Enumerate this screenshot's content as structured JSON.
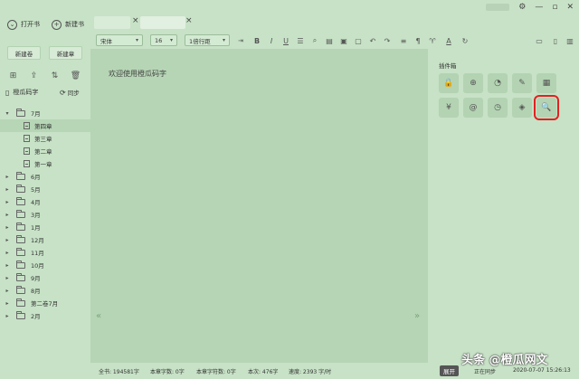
{
  "topbar": {
    "open_book": "打开书",
    "new_book": "新建书",
    "tab_close": "×"
  },
  "toolbar": {
    "font": "宋体",
    "size": "16",
    "line_spacing": "1倍行距"
  },
  "left": {
    "new_volume": "新建卷",
    "new_chapter": "新建章",
    "book_name": "橙瓜码字",
    "sync": "同步"
  },
  "tree": [
    {
      "label": "7月",
      "type": "folder",
      "expanded": true
    },
    {
      "label": "第四章",
      "type": "doc",
      "active": true
    },
    {
      "label": "第三章",
      "type": "doc"
    },
    {
      "label": "第二章",
      "type": "doc"
    },
    {
      "label": "第一章",
      "type": "doc"
    },
    {
      "label": "6月",
      "type": "folder"
    },
    {
      "label": "5月",
      "type": "folder"
    },
    {
      "label": "4月",
      "type": "folder"
    },
    {
      "label": "3月",
      "type": "folder"
    },
    {
      "label": "1月",
      "type": "folder"
    },
    {
      "label": "12月",
      "type": "folder"
    },
    {
      "label": "11月",
      "type": "folder"
    },
    {
      "label": "10月",
      "type": "folder"
    },
    {
      "label": "9月",
      "type": "folder"
    },
    {
      "label": "8月",
      "type": "folder"
    },
    {
      "label": "第二卷7月",
      "type": "folder"
    },
    {
      "label": "2月",
      "type": "folder"
    }
  ],
  "editor": {
    "welcome": "欢迎使用橙瓜码字"
  },
  "plugins": {
    "title": "插件箱",
    "tiles": [
      {
        "icon": "lock-icon",
        "glyph": "🔒"
      },
      {
        "icon": "search-doc-icon",
        "glyph": "⊕"
      },
      {
        "icon": "head-icon",
        "glyph": "◔"
      },
      {
        "icon": "pencil-icon",
        "glyph": "✎"
      },
      {
        "icon": "table-icon",
        "glyph": "▦"
      },
      {
        "icon": "yen-icon",
        "glyph": "¥"
      },
      {
        "icon": "at-icon",
        "glyph": "@"
      },
      {
        "icon": "clock-icon",
        "glyph": "◷"
      },
      {
        "icon": "tag-icon",
        "glyph": "◈"
      },
      {
        "icon": "doc-search-icon",
        "glyph": "🔍",
        "highlighted": true
      }
    ]
  },
  "status": {
    "total_words": "全书: 194581字",
    "chapter_words": "本章字数: 0字",
    "chapter_chars": "本章字符数: 0字",
    "session": "本次: 476字",
    "speed": "速度: 2393 字/时",
    "expand": "展开",
    "syncing": "正在同步",
    "datetime": "2020-07-07 15:26:13"
  },
  "watermark": "头条 @橙瓜网文",
  "colors": {
    "background": "#c7e2c6",
    "editor": "#b6d5b5",
    "highlight": "#e02121"
  }
}
